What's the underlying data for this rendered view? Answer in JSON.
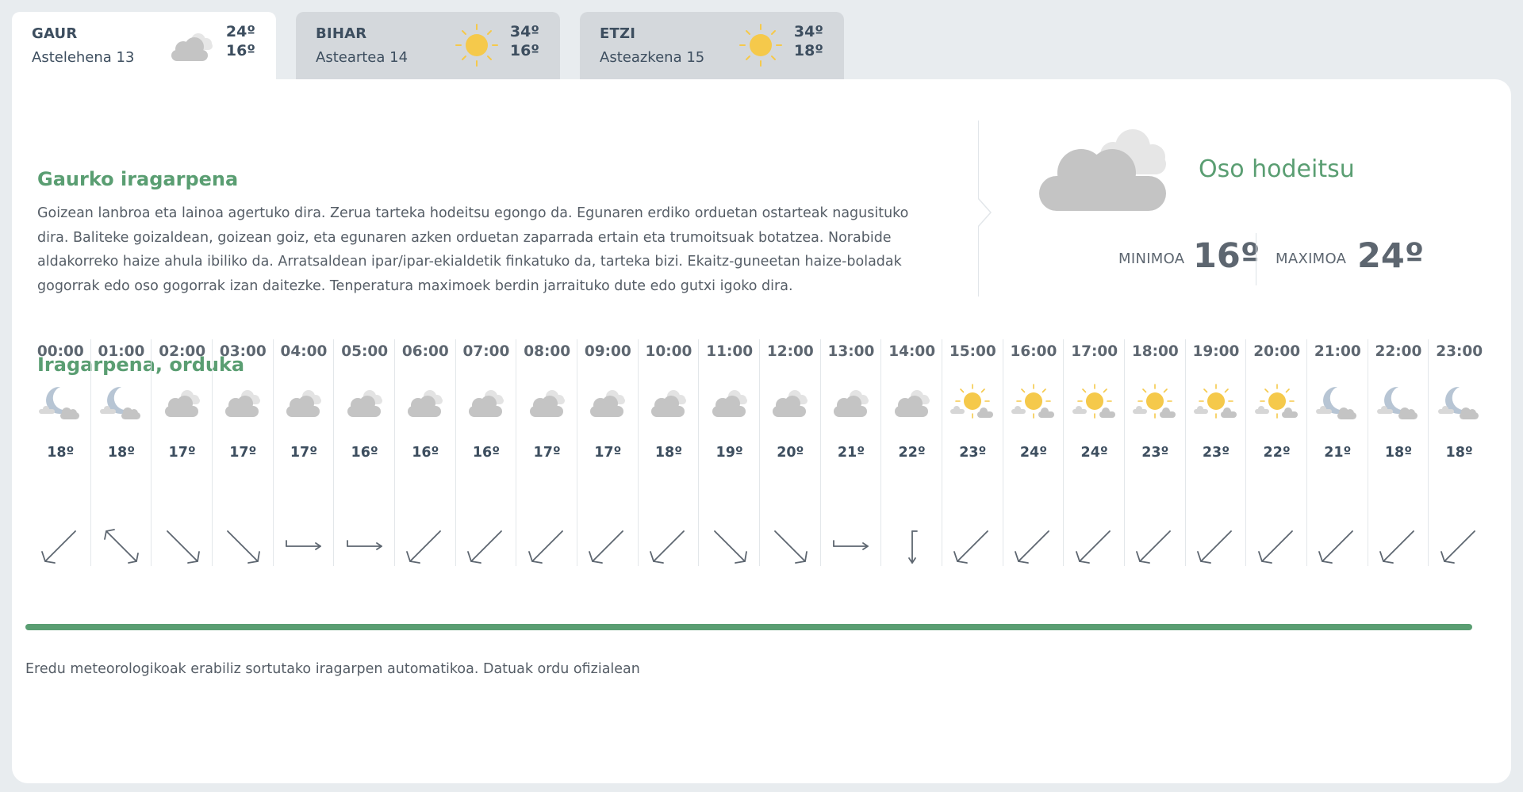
{
  "tabs": [
    {
      "name": "GAUR",
      "date": "Astelehena 13",
      "max": "24º",
      "min": "16º",
      "icon": "cloud-icon",
      "active": true
    },
    {
      "name": "BIHAR",
      "date": "Asteartea 14",
      "max": "34º",
      "min": "16º",
      "icon": "sun-icon",
      "active": false
    },
    {
      "name": "ETZI",
      "date": "Asteazkena 15",
      "max": "34º",
      "min": "18º",
      "icon": "sun-icon",
      "active": false
    }
  ],
  "today": {
    "title": "Gaurko iragarpena",
    "text": "Goizean lanbroa eta lainoa agertuko dira. Zerua tarteka hodeitsu egongo da. Egunaren erdiko orduetan ostarteak nagusituko dira. Baliteke goizaldean, goizean goiz, eta egunaren azken orduetan zaparrada ertain eta trumoitsuak botatzea. Norabide aldakorreko haize ahula ibiliko da. Arratsaldean ipar/ipar-ekialdetik finkatuko da, tarteka bizi. Ekaitz-guneetan haize-boladak gogorrak edo oso gogorrak izan daitezke. Tenperatura maximoek berdin jarraituko dute edo gutxi igoko dira.",
    "condition": "Oso hodeitsu",
    "condition_icon": "overcast-cloud-icon",
    "min_label": "MINIMOA",
    "min_value": "16º",
    "max_label": "MAXIMOA",
    "max_value": "24º"
  },
  "hourly": {
    "title": "Iragarpena, orduka",
    "hours": [
      {
        "time": "00:00",
        "icon": "night-cloud",
        "temp": "18º",
        "wind": "ne"
      },
      {
        "time": "01:00",
        "icon": "night-cloud",
        "temp": "18º",
        "wind": "diag-both"
      },
      {
        "time": "02:00",
        "icon": "cloud",
        "temp": "17º",
        "wind": "se"
      },
      {
        "time": "03:00",
        "icon": "cloud",
        "temp": "17º",
        "wind": "se"
      },
      {
        "time": "04:00",
        "icon": "cloud",
        "temp": "17º",
        "wind": "e"
      },
      {
        "time": "05:00",
        "icon": "cloud",
        "temp": "16º",
        "wind": "e"
      },
      {
        "time": "06:00",
        "icon": "cloud",
        "temp": "16º",
        "wind": "ne"
      },
      {
        "time": "07:00",
        "icon": "cloud",
        "temp": "16º",
        "wind": "ne"
      },
      {
        "time": "08:00",
        "icon": "cloud",
        "temp": "17º",
        "wind": "ne"
      },
      {
        "time": "09:00",
        "icon": "cloud",
        "temp": "17º",
        "wind": "ne"
      },
      {
        "time": "10:00",
        "icon": "cloud",
        "temp": "18º",
        "wind": "ne"
      },
      {
        "time": "11:00",
        "icon": "cloud",
        "temp": "19º",
        "wind": "se"
      },
      {
        "time": "12:00",
        "icon": "cloud",
        "temp": "20º",
        "wind": "se"
      },
      {
        "time": "13:00",
        "icon": "cloud",
        "temp": "21º",
        "wind": "e"
      },
      {
        "time": "14:00",
        "icon": "cloud",
        "temp": "22º",
        "wind": "s"
      },
      {
        "time": "15:00",
        "icon": "sun-cloud",
        "temp": "23º",
        "wind": "sw"
      },
      {
        "time": "16:00",
        "icon": "sun-cloud",
        "temp": "24º",
        "wind": "sw"
      },
      {
        "time": "17:00",
        "icon": "sun-cloud",
        "temp": "24º",
        "wind": "sw"
      },
      {
        "time": "18:00",
        "icon": "sun-cloud",
        "temp": "23º",
        "wind": "sw"
      },
      {
        "time": "19:00",
        "icon": "sun-cloud",
        "temp": "23º",
        "wind": "sw"
      },
      {
        "time": "20:00",
        "icon": "sun-cloud",
        "temp": "22º",
        "wind": "sw"
      },
      {
        "time": "21:00",
        "icon": "night-cloud",
        "temp": "21º",
        "wind": "sw"
      },
      {
        "time": "22:00",
        "icon": "night-cloud",
        "temp": "18º",
        "wind": "sw"
      },
      {
        "time": "23:00",
        "icon": "night-cloud",
        "temp": "18º",
        "wind": "sw"
      }
    ]
  },
  "footnote": "Eredu meteorologikoak erabiliz sortutako iragarpen automatikoa. Datuak ordu ofizialean",
  "colors": {
    "accent": "#5a9e72",
    "text": "#3d4e5f",
    "sun": "#f5c94b",
    "moon": "#b7c5d4",
    "cloud": "#c4c4c4"
  }
}
